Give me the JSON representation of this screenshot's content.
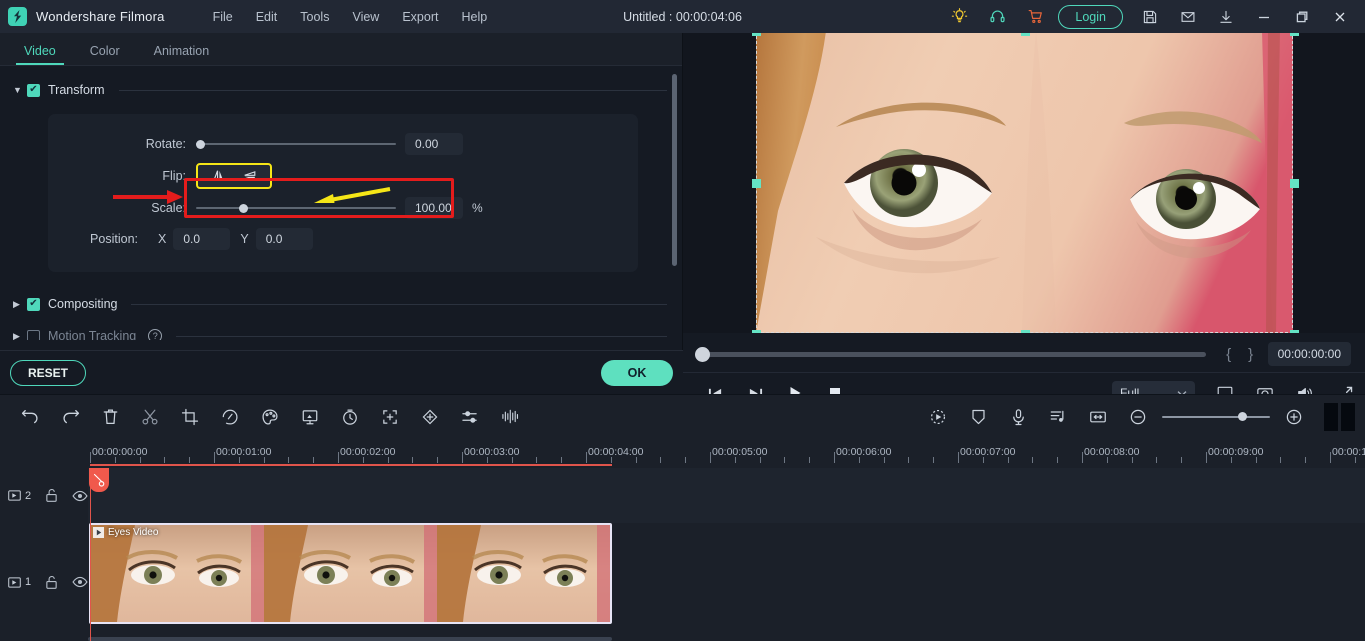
{
  "app": {
    "brand": "Wondershare Filmora",
    "document_title": "Untitled : 00:00:04:06",
    "logo_icon": "filmora-diamond-logo"
  },
  "menubar": {
    "items": [
      {
        "label": "File"
      },
      {
        "label": "Edit"
      },
      {
        "label": "Tools"
      },
      {
        "label": "View"
      },
      {
        "label": "Export"
      },
      {
        "label": "Help"
      }
    ]
  },
  "titlebar_actions": {
    "tips_icon": "lightbulb-icon",
    "support_icon": "headset-icon",
    "store_icon": "cart-icon",
    "login_label": "Login",
    "save_icon": "save-disk-icon",
    "mail_icon": "envelope-icon",
    "download_icon": "download-icon",
    "minimize_icon": "minimize-icon",
    "restore_icon": "restore-window-icon",
    "close_icon": "close-icon"
  },
  "properties": {
    "tabs": [
      {
        "label": "Video",
        "active": true
      },
      {
        "label": "Color",
        "active": false
      },
      {
        "label": "Animation",
        "active": false
      }
    ],
    "sections": {
      "transform": {
        "label": "Transform",
        "checked": true,
        "expanded": true,
        "rotate": {
          "label": "Rotate:",
          "value": "0.00",
          "slider_pct": 0
        },
        "flip": {
          "label": "Flip:",
          "horizontal_icon": "flip-horizontal-icon",
          "vertical_icon": "flip-vertical-icon"
        },
        "scale": {
          "label": "Scale:",
          "value": "100.00",
          "unit": "%",
          "slider_pct": 24
        },
        "position": {
          "label": "Position:",
          "x_axis": "X",
          "x_value": "0.0",
          "y_axis": "Y",
          "y_value": "0.0"
        }
      },
      "compositing": {
        "label": "Compositing",
        "checked": true,
        "expanded": false
      },
      "motion_tracking": {
        "label": "Motion Tracking",
        "checked": false,
        "expanded": false,
        "help_icon": "question-mark-icon"
      }
    },
    "footer": {
      "reset_label": "RESET",
      "ok_label": "OK"
    }
  },
  "annotations": {
    "red_rectangle": "highlight-box-around-flip-control",
    "red_arrow": "pointer-arrow-to-flip-row",
    "yellow_rectangle": "highlight-box-around-flip-buttons",
    "yellow_arrow": "pointer-arrow-to-flip-buttons"
  },
  "preview": {
    "selection_handles": 8,
    "playhead_position_pct": 0,
    "timecode": "00:00:00:00",
    "mark_in_icon": "{",
    "mark_out_icon": "}",
    "transport": {
      "prev_frame_icon": "previous-frame-icon",
      "next_frame_icon": "next-frame-icon",
      "play_icon": "play-icon",
      "stop_icon": "stop-icon"
    },
    "quality_label": "Full",
    "quality_dropdown_icon": "chevron-down-icon",
    "snapshot_to_pc_icon": "export-to-display-icon",
    "camera_icon": "camera-snapshot-icon",
    "volume_icon": "speaker-volume-icon",
    "fullscreen_icon": "fullscreen-expand-icon"
  },
  "timeline_toolbar": {
    "left_icons": [
      {
        "name": "undo-icon"
      },
      {
        "name": "redo-icon"
      },
      {
        "name": "delete-icon"
      },
      {
        "name": "split-scissors-icon"
      },
      {
        "name": "crop-icon"
      },
      {
        "name": "speed-icon"
      },
      {
        "name": "color-palette-icon"
      },
      {
        "name": "green-screen-icon"
      },
      {
        "name": "stopwatch-icon"
      },
      {
        "name": "auto-enhance-icon"
      },
      {
        "name": "keyframe-icon"
      },
      {
        "name": "adjust-sliders-icon"
      },
      {
        "name": "audio-waveform-icon"
      }
    ],
    "right_icons": [
      {
        "name": "motion-tracking-icon"
      },
      {
        "name": "mask-shield-icon"
      },
      {
        "name": "voiceover-mic-icon"
      },
      {
        "name": "audio-detach-icon"
      },
      {
        "name": "fit-to-timeline-icon"
      },
      {
        "name": "zoom-out-icon"
      },
      {
        "name": "zoom-in-icon"
      },
      {
        "name": "render-preview-icon"
      }
    ],
    "zoom_slider_pct": 70
  },
  "timeline": {
    "add_track_icon": "add-track-icon",
    "link_icon": "link-clips-icon",
    "ruler_labels": [
      "00:00:00:00",
      "00:00:01:00",
      "00:00:02:00",
      "00:00:03:00",
      "00:00:04:00",
      "00:00:05:00",
      "00:00:06:00",
      "00:00:07:00",
      "00:00:08:00",
      "00:00:09:00",
      "00:00:1"
    ],
    "tracks": [
      {
        "number": "2",
        "track_icon": "video-track-icon",
        "lock_icon": "unlocked-padlock-icon",
        "eye_icon": "visibility-eye-icon",
        "clips": []
      },
      {
        "number": "1",
        "track_icon": "video-track-icon",
        "lock_icon": "unlocked-padlock-icon",
        "eye_icon": "visibility-eye-icon",
        "clips": [
          {
            "label": "Eyes Video",
            "play_icon": "clip-play-icon"
          }
        ]
      }
    ]
  }
}
